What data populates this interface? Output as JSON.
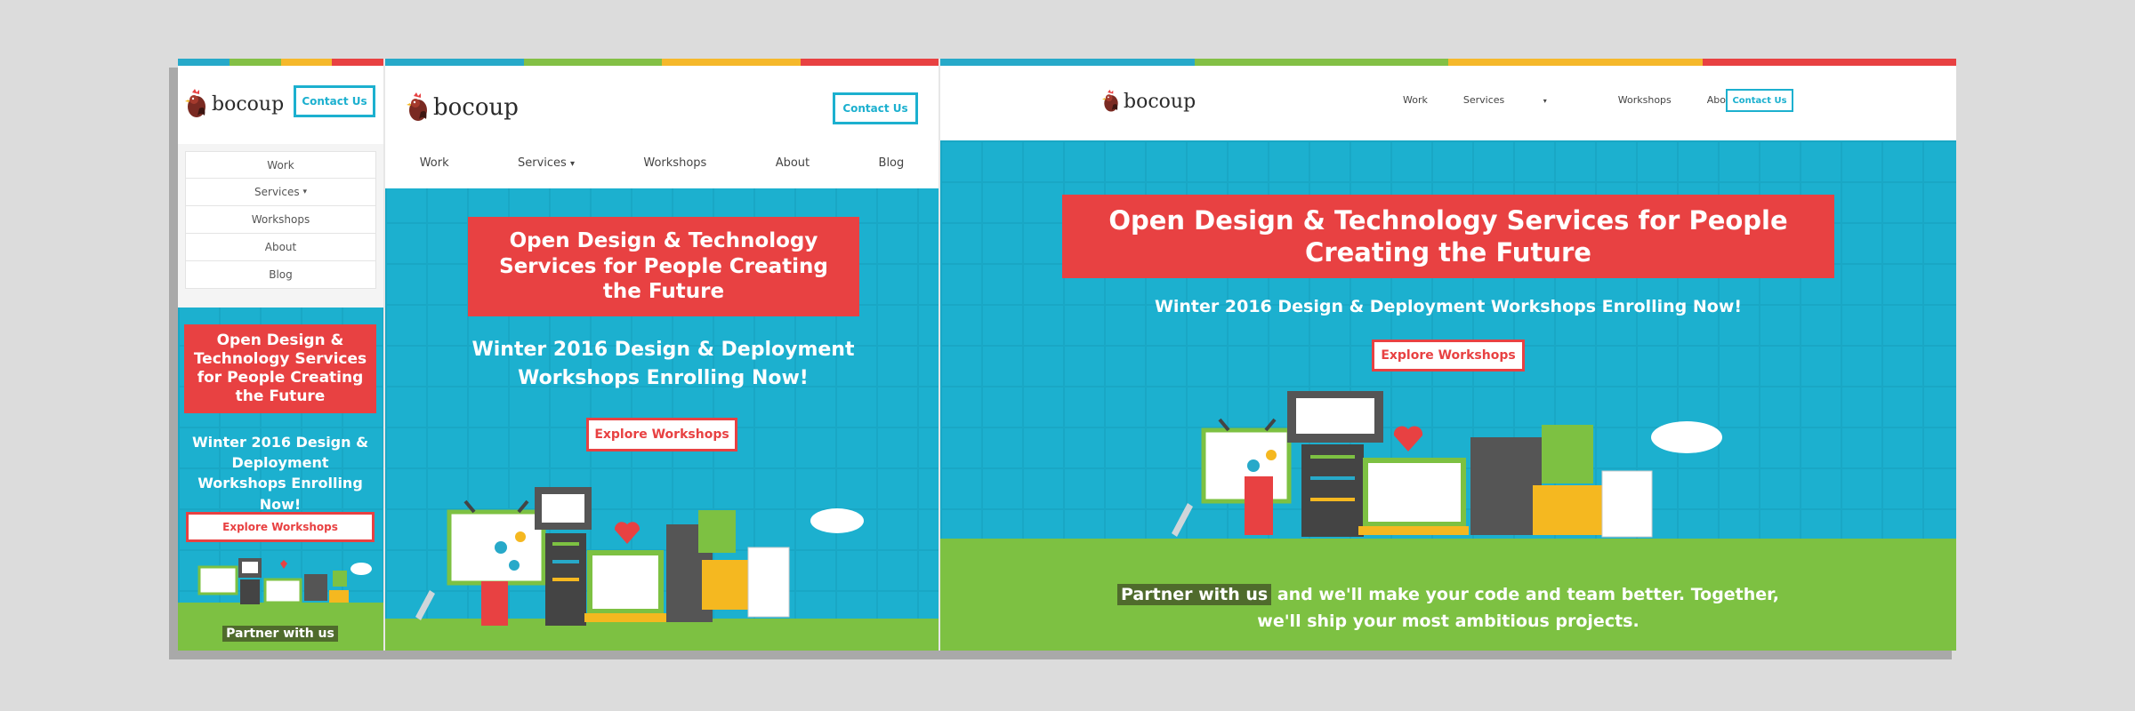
{
  "brand": {
    "name": "bocoup"
  },
  "colors": {
    "accent": "#1cb0cf",
    "red": "#e84142",
    "green": "#7dc142",
    "yellow": "#f5b820",
    "stripe": [
      "#27a9c9",
      "#83c045",
      "#f5b82b",
      "#e84142"
    ]
  },
  "nav": {
    "items": [
      "Work",
      "Services",
      "Workshops",
      "About",
      "Blog"
    ],
    "services_caret": "▾"
  },
  "contact_label": "Contact Us",
  "hero": {
    "headline": "Open Design & Technology Services for People Creating the Future",
    "subline": "Winter 2016 Design & Deployment Workshops Enrolling Now!",
    "cta": "Explore Workshops"
  },
  "partner": {
    "highlight": "Partner with us",
    "rest": " and we'll make your code and team better. Together, we'll ship your most ambitious projects."
  },
  "icons": [
    "rooster-logo-icon",
    "wrench-icon",
    "easel-icon",
    "monitor-icon",
    "server-icon",
    "heart-icon",
    "cloud-icon",
    "calculator-icon",
    "document-icon",
    "brackets-icon"
  ]
}
